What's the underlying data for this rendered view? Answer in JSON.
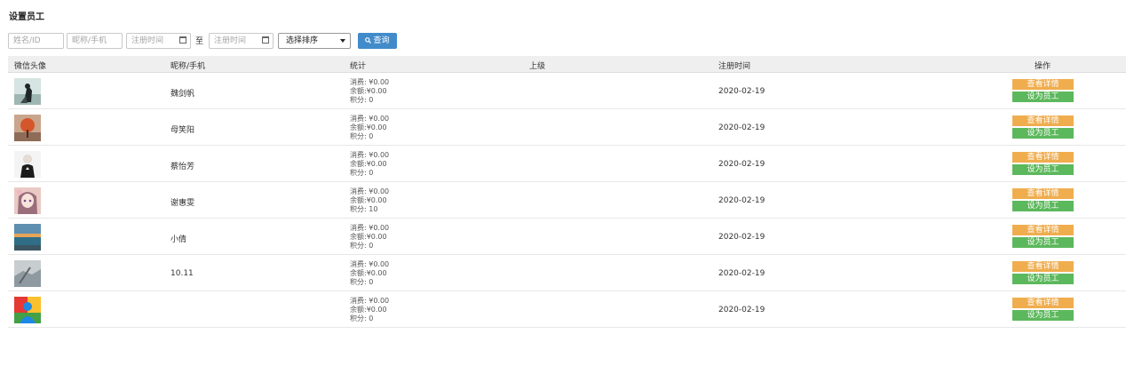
{
  "page": {
    "title": "设置员工"
  },
  "filters": {
    "name_placeholder": "姓名/ID",
    "nick_placeholder": "昵称/手机",
    "reg_start_placeholder": "注册时间",
    "to_label": "至",
    "reg_end_placeholder": "注册时间",
    "sort_selected": "选择排序",
    "query_label": "查询"
  },
  "table": {
    "headers": [
      "微信头像",
      "昵称/手机",
      "统计",
      "上级",
      "注册时间",
      "操作"
    ],
    "rows": [
      {
        "nick": "魏剑帆",
        "stats": [
          "消费: ¥0.00",
          "余额:¥0.00",
          "积分: 0"
        ],
        "parent": "",
        "date": "2020-02-19",
        "view_label": "查看详情",
        "set_label": "设为员工",
        "avatar": "avatar-dark-figure"
      },
      {
        "nick": "母笑阳",
        "stats": [
          "消费: ¥0.00",
          "余额:¥0.00",
          "积分: 0"
        ],
        "parent": "",
        "date": "2020-02-19",
        "view_label": "查看详情",
        "set_label": "设为员工",
        "avatar": "avatar-orange-tree"
      },
      {
        "nick": "蔡怡芳",
        "stats": [
          "消费: ¥0.00",
          "余额:¥0.00",
          "积分: 0"
        ],
        "parent": "",
        "date": "2020-02-19",
        "view_label": "查看详情",
        "set_label": "设为员工",
        "avatar": "avatar-person-white"
      },
      {
        "nick": "谢惠雯",
        "stats": [
          "消费: ¥0.00",
          "余额:¥0.00",
          "积分: 10"
        ],
        "parent": "",
        "date": "2020-02-19",
        "view_label": "查看详情",
        "set_label": "设为员工",
        "avatar": "avatar-anime-girl"
      },
      {
        "nick": "小倩",
        "stats": [
          "消费: ¥0.00",
          "余额:¥0.00",
          "积分: 0"
        ],
        "parent": "",
        "date": "2020-02-19",
        "view_label": "查看详情",
        "set_label": "设为员工",
        "avatar": "avatar-sea-sunset"
      },
      {
        "nick": "10.11",
        "stats": [
          "消费: ¥0.00",
          "余额:¥0.00",
          "积分: 0"
        ],
        "parent": "",
        "date": "2020-02-19",
        "view_label": "查看详情",
        "set_label": "设为员工",
        "avatar": "avatar-grey-landscape"
      },
      {
        "nick": "",
        "stats": [
          "消费: ¥0.00",
          "余额:¥0.00",
          "积分: 0"
        ],
        "parent": "",
        "date": "2020-02-19",
        "view_label": "查看详情",
        "set_label": "设为员工",
        "avatar": "avatar-default-person"
      }
    ]
  },
  "colors": {
    "view_button": "#f0ad4e",
    "set_button": "#5cb85c",
    "query_button": "#428bca",
    "header_bg": "#efefef"
  }
}
